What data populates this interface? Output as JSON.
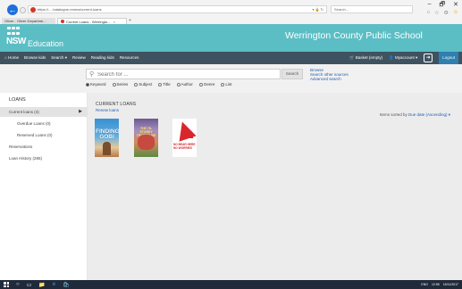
{
  "browser": {
    "url": "https://... /catalogue-renew/current-loans",
    "url_controls": "▾ 🔒 ↻",
    "search_placeholder": "Search...",
    "window_controls": [
      "–",
      "🗗",
      "✕"
    ],
    "tabs": [
      {
        "label": "Oliver - Oliver Departme..."
      },
      {
        "label": "Current Loans - Werringto..."
      }
    ],
    "tab_close": "×",
    "new_tab": "+",
    "tool_icons": [
      "⌂",
      "☆",
      "⚙",
      "☺"
    ]
  },
  "header": {
    "logo_text": "NSW",
    "logo_sub": "Education",
    "school_name": "Werrington County Public School"
  },
  "nav": {
    "left_items": [
      "⌂ Home",
      "Browse kids",
      "Search ▾",
      "Review",
      "Reading kids",
      "Resources"
    ],
    "basket": "🛒 Basket (empty)",
    "user": "👤 Myaccount ▾",
    "logout_icon": "➜",
    "logout": "Logout"
  },
  "search": {
    "placeholder": "Search for ...",
    "button": "Search",
    "links": [
      "Browse",
      "Search other sources",
      "Advanced search"
    ],
    "options": [
      {
        "label": "Keyword",
        "selected": true
      },
      {
        "label": "Series",
        "selected": false
      },
      {
        "label": "Subject",
        "selected": false
      },
      {
        "label": "Title",
        "selected": false
      },
      {
        "label": "Author",
        "selected": false
      },
      {
        "label": "Genre",
        "selected": false
      },
      {
        "label": "List",
        "selected": false
      }
    ]
  },
  "sidebar": {
    "title": "LOANS",
    "items": [
      {
        "label": "Current loans (3)",
        "active": true,
        "indent": false
      },
      {
        "label": "Overdue Loans (0)",
        "active": false,
        "indent": true
      },
      {
        "label": "Reserved Loans (0)",
        "active": false,
        "indent": true
      },
      {
        "label": "Reservations",
        "active": false,
        "indent": false
      },
      {
        "label": "Loan History (285)",
        "active": false,
        "indent": false
      }
    ],
    "active_arrow": "▶"
  },
  "main": {
    "title": "CURRENT LOANS",
    "renew_link": "Renew loans",
    "sort_prefix": "Items sorted by ",
    "sort_value": "Due date (Ascending) ▾",
    "books": [
      {
        "cover_text": "FINDING GOBI",
        "color": "#3a8fd0"
      },
      {
        "cover_text": "THE 78-STOREY TREEHOUSE",
        "color": "#6b5a8d"
      },
      {
        "cover_text": "NO BEAR HERE NO WORRIES",
        "color": "#d8262c"
      }
    ]
  },
  "taskbar": {
    "search_glyph": "○",
    "apps": [
      "▭",
      "📁",
      "e",
      "🛍"
    ],
    "time": "12:55",
    "date": "15/11/2017",
    "lang": "ENG"
  }
}
